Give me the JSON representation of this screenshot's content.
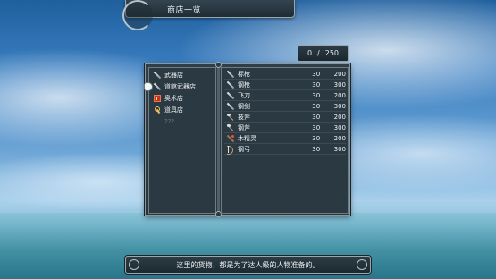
{
  "title": "商店一览",
  "counter": {
    "current": "0",
    "separator": "/",
    "max": "250"
  },
  "categories": [
    {
      "label": "武器店",
      "icon": "sword-icon",
      "selected": false
    },
    {
      "label": "道館武器店",
      "icon": "sword-icon",
      "selected": true
    },
    {
      "label": "奥术店",
      "icon": "spellbook-icon",
      "selected": false
    },
    {
      "label": "道具店",
      "icon": "key-icon",
      "selected": false
    },
    {
      "label": "???",
      "icon": "",
      "selected": false
    }
  ],
  "items": [
    {
      "name": "标枪",
      "icon": "sword-icon",
      "qty": "30",
      "price": "200"
    },
    {
      "name": "钢枪",
      "icon": "sword-icon",
      "qty": "30",
      "price": "300"
    },
    {
      "name": "飞刀",
      "icon": "sword-icon",
      "qty": "30",
      "price": "200"
    },
    {
      "name": "钢剑",
      "icon": "sword-icon",
      "qty": "30",
      "price": "300"
    },
    {
      "name": "技斧",
      "icon": "axe-icon",
      "qty": "30",
      "price": "200"
    },
    {
      "name": "钢斧",
      "icon": "axe-icon",
      "qty": "30",
      "price": "300"
    },
    {
      "name": "木精灵",
      "icon": "staff-icon",
      "qty": "30",
      "price": "200"
    },
    {
      "name": "钢弓",
      "icon": "bow-icon",
      "qty": "30",
      "price": "300"
    }
  ],
  "message": "这里的货物，都是为了达人级的人物准备的。"
}
